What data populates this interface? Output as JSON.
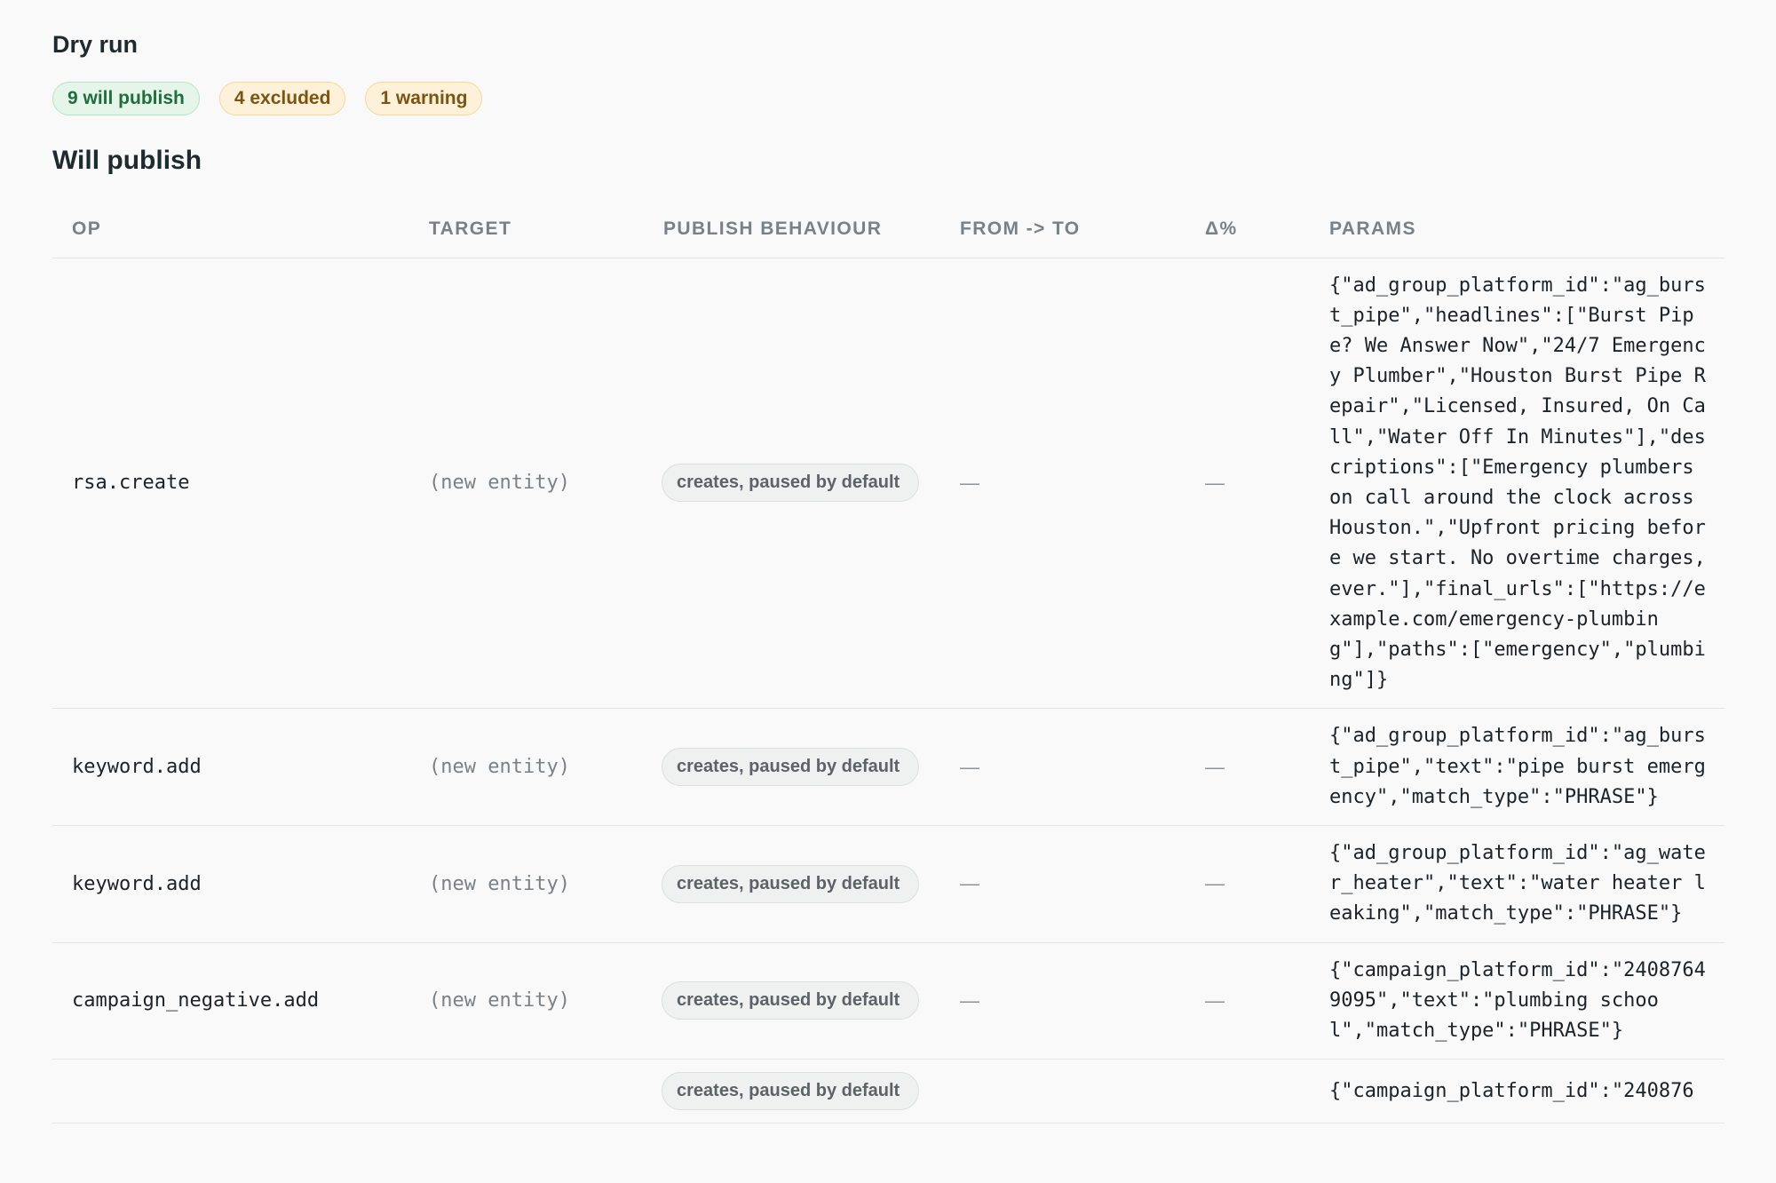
{
  "header": {
    "title": "Dry run"
  },
  "badges": {
    "publish": "9 will publish",
    "excluded": "4 excluded",
    "warning": "1 warning"
  },
  "section": {
    "title": "Will publish"
  },
  "table": {
    "columns": {
      "op": "OP",
      "target": "TARGET",
      "behaviour": "PUBLISH BEHAVIOUR",
      "from_to": "FROM -> TO",
      "delta": "Δ%",
      "params": "PARAMS"
    },
    "rows": [
      {
        "op": "rsa.create",
        "target": "(new entity)",
        "behaviour": "creates, paused by default",
        "from_to": "—",
        "delta": "—",
        "params": "{\"ad_group_platform_id\":\"ag_burst_pipe\",\"headlines\":[\"Burst Pipe? We Answer Now\",\"24/7 Emergency Plumber\",\"Houston Burst Pipe Repair\",\"Licensed, Insured, On Call\",\"Water Off In Minutes\"],\"descriptions\":[\"Emergency plumbers on call around the clock across Houston.\",\"Upfront pricing before we start. No overtime charges, ever.\"],\"final_urls\":[\"https://example.com/emergency-plumbing\"],\"paths\":[\"emergency\",\"plumbing\"]}"
      },
      {
        "op": "keyword.add",
        "target": "(new entity)",
        "behaviour": "creates, paused by default",
        "from_to": "—",
        "delta": "—",
        "params": "{\"ad_group_platform_id\":\"ag_burst_pipe\",\"text\":\"pipe burst emergency\",\"match_type\":\"PHRASE\"}"
      },
      {
        "op": "keyword.add",
        "target": "(new entity)",
        "behaviour": "creates, paused by default",
        "from_to": "—",
        "delta": "—",
        "params": "{\"ad_group_platform_id\":\"ag_water_heater\",\"text\":\"water heater leaking\",\"match_type\":\"PHRASE\"}"
      },
      {
        "op": "campaign_negative.add",
        "target": "(new entity)",
        "behaviour": "creates, paused by default",
        "from_to": "—",
        "delta": "—",
        "params": "{\"campaign_platform_id\":\"24087649095\",\"text\":\"plumbing school\",\"match_type\":\"PHRASE\"}"
      },
      {
        "op": "",
        "target": "",
        "behaviour": "creates, paused by default",
        "from_to": "",
        "delta": "",
        "params": "{\"campaign_platform_id\":\"240876"
      }
    ]
  }
}
